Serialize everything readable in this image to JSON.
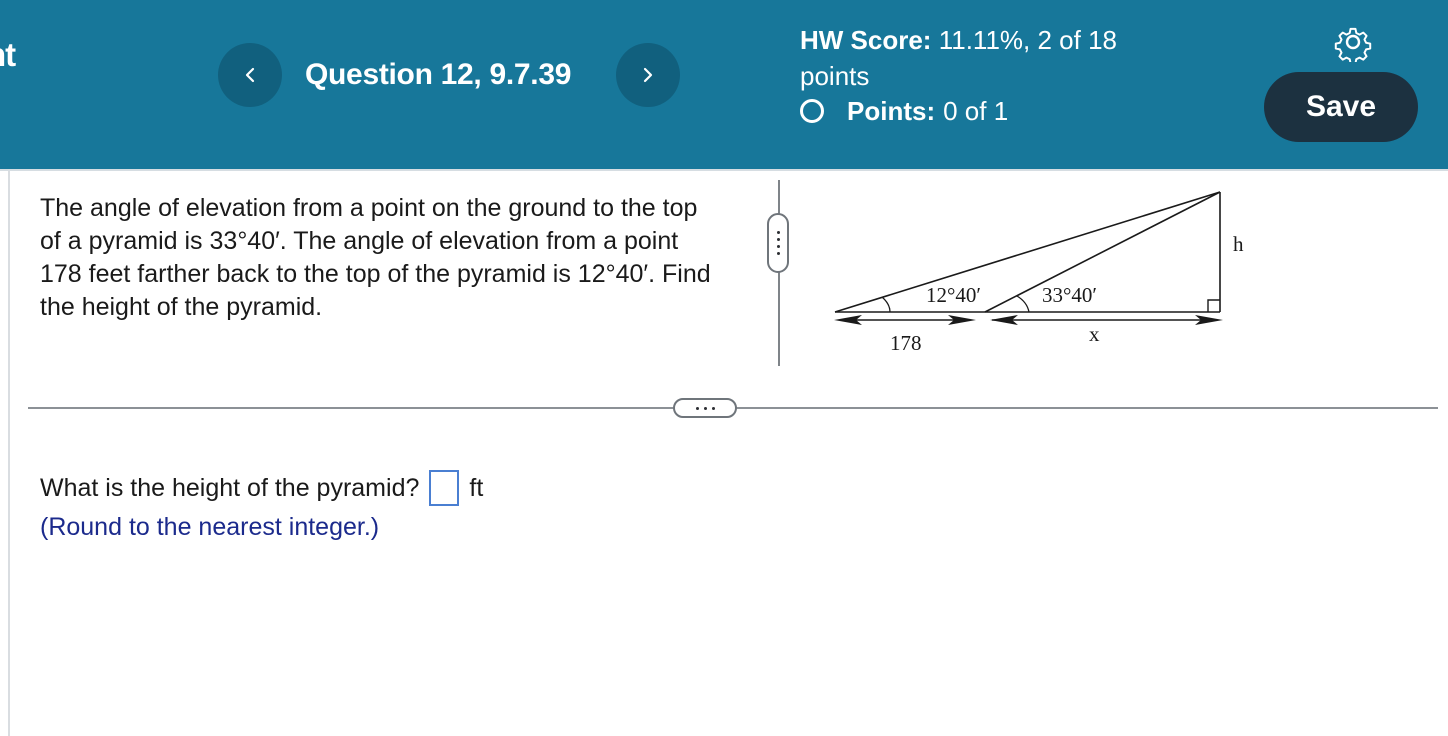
{
  "header": {
    "left_cut_text": "nt",
    "question_title": "Question 12, 9.7.39",
    "prev_icon": "chevron-left-icon",
    "next_icon": "chevron-right-icon",
    "hw_score_label": "HW Score:",
    "hw_score_value": "11.11%, 2 of 18",
    "hw_score_unit": "points",
    "points_label": "Points:",
    "points_value": "0 of 1",
    "settings_icon": "gear-icon",
    "save_label": "Save"
  },
  "problem": {
    "text": "The angle of elevation from a point on the ground to the top of a pyramid is 33°40′. The angle of elevation from a point 178 feet farther back to the top of the pyramid is 12°40′. Find the height of the pyramid."
  },
  "figure": {
    "angle1": "12°40′",
    "angle2": "33°40′",
    "distance_label": "178",
    "x_label": "x",
    "h_label": "h"
  },
  "answer": {
    "prompt": "What is the height of the pyramid?",
    "value": "",
    "unit": "ft",
    "hint": "(Round to the nearest integer.)"
  },
  "colors": {
    "header_bg": "#17779a",
    "nav_button_bg": "#11607e",
    "save_button_bg": "#1c3140",
    "hint_text": "#1b2a8c",
    "answer_box_border": "#4a7fd2"
  }
}
